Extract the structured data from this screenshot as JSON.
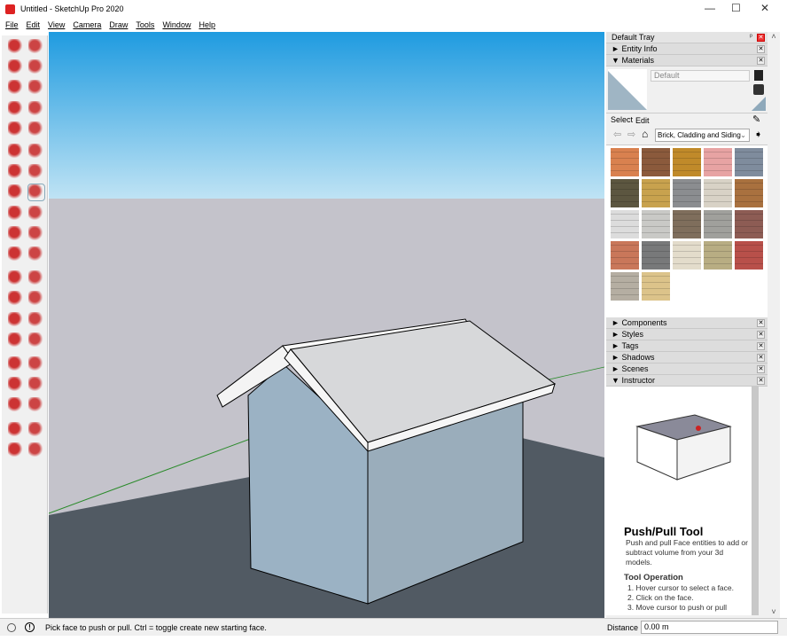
{
  "window": {
    "title": "Untitled - SketchUp Pro 2020",
    "minimize": "—",
    "maximize": "☐",
    "close": "✕"
  },
  "menu": [
    "File",
    "Edit",
    "View",
    "Camera",
    "Draw",
    "Tools",
    "Window",
    "Help"
  ],
  "toolbar_icons": [
    "select",
    "eraser",
    "paint-bucket",
    "eraser-alt",
    "line",
    "freehand",
    "rectangle",
    "rotated-rectangle",
    "circle",
    "polygon",
    "arc",
    "2-point-arc",
    "3-point-arc",
    "pie",
    "move",
    "push-pull",
    "rotate",
    "follow-me",
    "scale",
    "offset",
    "tape-measure",
    "dimension",
    "protractor",
    "text",
    "axes",
    "3d-text",
    "orbit",
    "pan",
    "zoom",
    "zoom-window",
    "zoom-extents",
    "previous",
    "position-camera",
    "look-around",
    "walk",
    "section-plane",
    "3d-warehouse",
    "extension-warehouse",
    "layout",
    "extension-manager"
  ],
  "tray": {
    "title": "Default Tray",
    "panels_top": [
      {
        "label": "Entity Info",
        "arrow": "►"
      },
      {
        "label": "Materials",
        "arrow": "▼"
      }
    ],
    "material_name": "Default",
    "tabs": [
      "Select",
      "Edit"
    ],
    "library": "Brick, Cladding and Siding",
    "swatch_colors": [
      "#d9814f",
      "#8b5a3c",
      "#c08a2a",
      "#e7a3a3",
      "#7f8c9d",
      "#5c5640",
      "#c8a24e",
      "#8b8d90",
      "#d8d2c6",
      "#a9713f",
      "#dcdcdc",
      "#c9c9c6",
      "#7f6e5c",
      "#a0a09c",
      "#8d5c54",
      "#c9775a",
      "#78797a",
      "#e3dccb",
      "#b8ad83",
      "#b8504a",
      "#b5aea2",
      "#dcc38a"
    ],
    "panels_bottom": [
      {
        "label": "Components",
        "arrow": "►"
      },
      {
        "label": "Styles",
        "arrow": "►"
      },
      {
        "label": "Tags",
        "arrow": "►"
      },
      {
        "label": "Shadows",
        "arrow": "►"
      },
      {
        "label": "Scenes",
        "arrow": "►"
      },
      {
        "label": "Instructor",
        "arrow": "▼"
      }
    ],
    "instructor": {
      "title": "Push/Pull Tool",
      "desc": "Push and pull Face entities to add or subtract volume from your 3d models.",
      "op_title": "Tool Operation",
      "steps": [
        "1. Hover cursor to select a face.",
        "2. Click on the face.",
        "3. Move cursor to push or pull"
      ]
    }
  },
  "status": {
    "hint": "Pick face to push or pull.  Ctrl = toggle create new starting face.",
    "distance_label": "Distance",
    "distance_value": "0.00 m"
  }
}
